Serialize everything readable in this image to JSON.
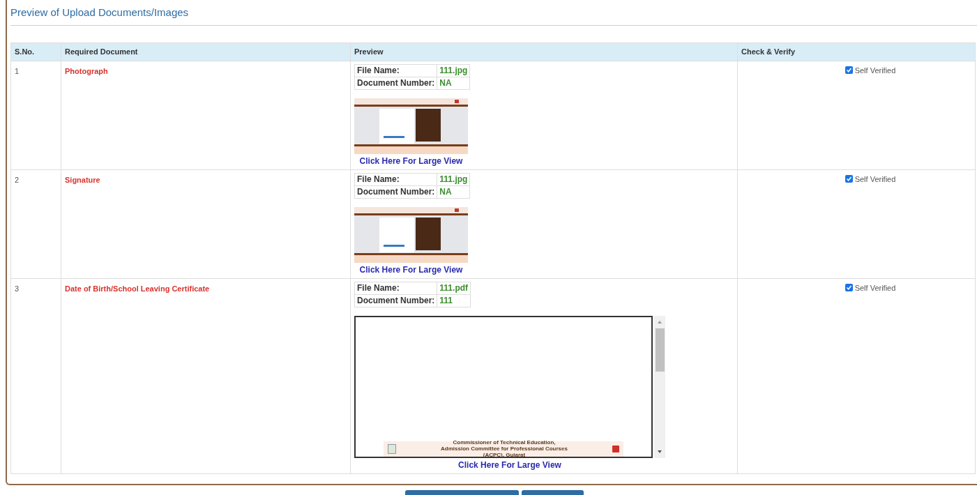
{
  "heading": "Preview of Upload Documents/Images",
  "table": {
    "columns": [
      "S.No.",
      "Required Document",
      "Preview",
      "Check & Verify"
    ],
    "rows": [
      {
        "sno": "1",
        "document": "Photograph",
        "file_name_label": "File Name:",
        "file_name": "111.jpg",
        "doc_number_label": "Document Number:",
        "doc_number": "NA",
        "link": "Click Here For Large View",
        "verify": {
          "label": "Self Verified",
          "checked": true
        }
      },
      {
        "sno": "2",
        "document": "Signature",
        "file_name_label": "File Name:",
        "file_name": "111.jpg",
        "doc_number_label": "Document Number:",
        "doc_number": "NA",
        "link": "Click Here For Large View",
        "verify": {
          "label": "Self Verified",
          "checked": true
        }
      },
      {
        "sno": "3",
        "document": "Date of Birth/School Leaving Certificate",
        "file_name_label": "File Name:",
        "file_name": "111.pdf",
        "doc_number_label": "Document Number:",
        "doc_number": "111",
        "preview": {
          "kind": "pdf",
          "header": "Commissioner of Technical Education, Admission Committee for Professional Courses (ACPC), Gujarat"
        },
        "link": "Click Here For Large View",
        "verify": {
          "label": "Self Verified",
          "checked": true
        }
      }
    ]
  },
  "buttons": [
    {
      "kind": "primary"
    },
    {
      "kind": "primary"
    }
  ]
}
